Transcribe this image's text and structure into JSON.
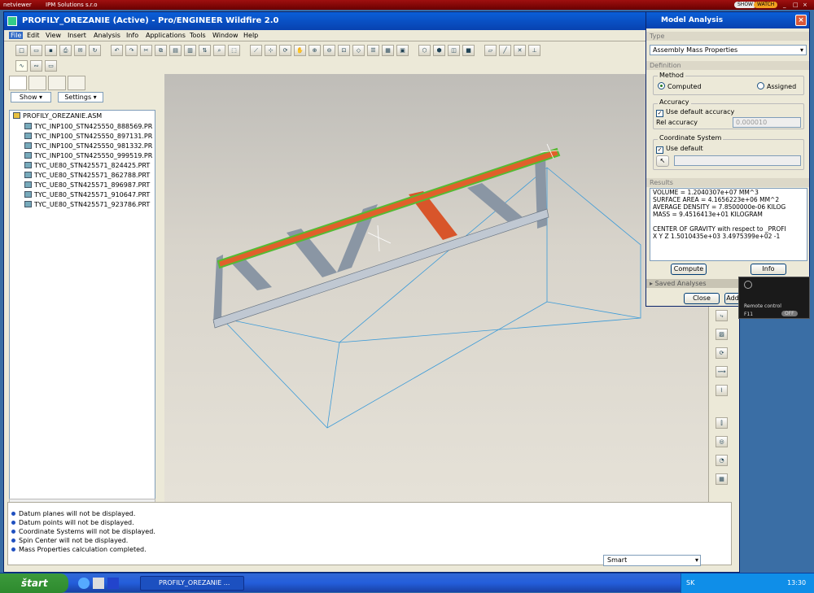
{
  "netviewer": {
    "brand": "netviewer",
    "company": "IPM Solutions s.r.o",
    "show_label": "SHOW",
    "watch_label": "WATCH"
  },
  "app": {
    "title": "PROFILY_OREZANIE (Active) - Pro/ENGINEER Wildfire 2.0"
  },
  "menu": [
    "File",
    "Edit",
    "View",
    "Insert",
    "Analysis",
    "Info",
    "Applications",
    "Tools",
    "Window",
    "Help"
  ],
  "navigator": {
    "show_label": "Show",
    "settings_label": "Settings",
    "root": "PROFILY_OREZANIE.ASM",
    "parts": [
      "TYC_INP100_STN425550_888569.PR",
      "TYC_INP100_STN425550_897131.PR",
      "TYC_INP100_STN425550_981332.PR",
      "TYC_INP100_STN425550_999519.PR",
      "TYC_UE80_STN425571_824425.PRT",
      "TYC_UE80_STN425571_862788.PRT",
      "TYC_UE80_STN425571_896987.PRT",
      "TYC_UE80_STN425571_910647.PRT",
      "TYC_UE80_STN425571_923786.PRT"
    ]
  },
  "messages": [
    "Datum planes will not be displayed.",
    "Datum points will not be displayed.",
    "Coordinate Systems will not be displayed.",
    "Spin Center will not be displayed.",
    "Mass Properties calculation completed."
  ],
  "filter": {
    "value": "Smart"
  },
  "model_analysis": {
    "title": "Model Analysis",
    "type_label": "Type",
    "type_value": "Assembly Mass Properties",
    "definition_label": "Definition",
    "method_label": "Method",
    "computed_label": "Computed",
    "assigned_label": "Assigned",
    "accuracy_label": "Accuracy",
    "use_default_accuracy": "Use default accuracy",
    "rel_accuracy_label": "Rel accuracy",
    "rel_accuracy_value": "0.000010",
    "coord_label": "Coordinate System",
    "use_default": "Use default",
    "results_label": "Results",
    "results": [
      "VOLUME = 1.2040307e+07  MM^3",
      "SURFACE AREA = 4.1656223e+06  MM^2",
      "AVERAGE DENSITY = 7.8500000e-06 KILOG",
      "MASS = 9.4516413e+01 KILOGRAM",
      "",
      "CENTER OF GRAVITY with respect to _PROFI",
      "X  Y  Z    1.5010435e+03  3.4975399e+02 -1"
    ],
    "compute_label": "Compute",
    "info_label": "Info",
    "saved_label": "Saved Analyses",
    "close_label": "Close",
    "add_label": "Add"
  },
  "remote": {
    "label": "Remote control",
    "f11": "F11",
    "off": "OFF"
  },
  "taskbar": {
    "start_label": "štart",
    "task_label": "PROFILY_OREZANIE ...",
    "lang": "SK",
    "time": "13:30"
  },
  "colors": {
    "top_beam": "#e0602a",
    "beam_edge": "#55bb33",
    "steel": "#8a96a4",
    "datum": "#3a9ad8"
  }
}
